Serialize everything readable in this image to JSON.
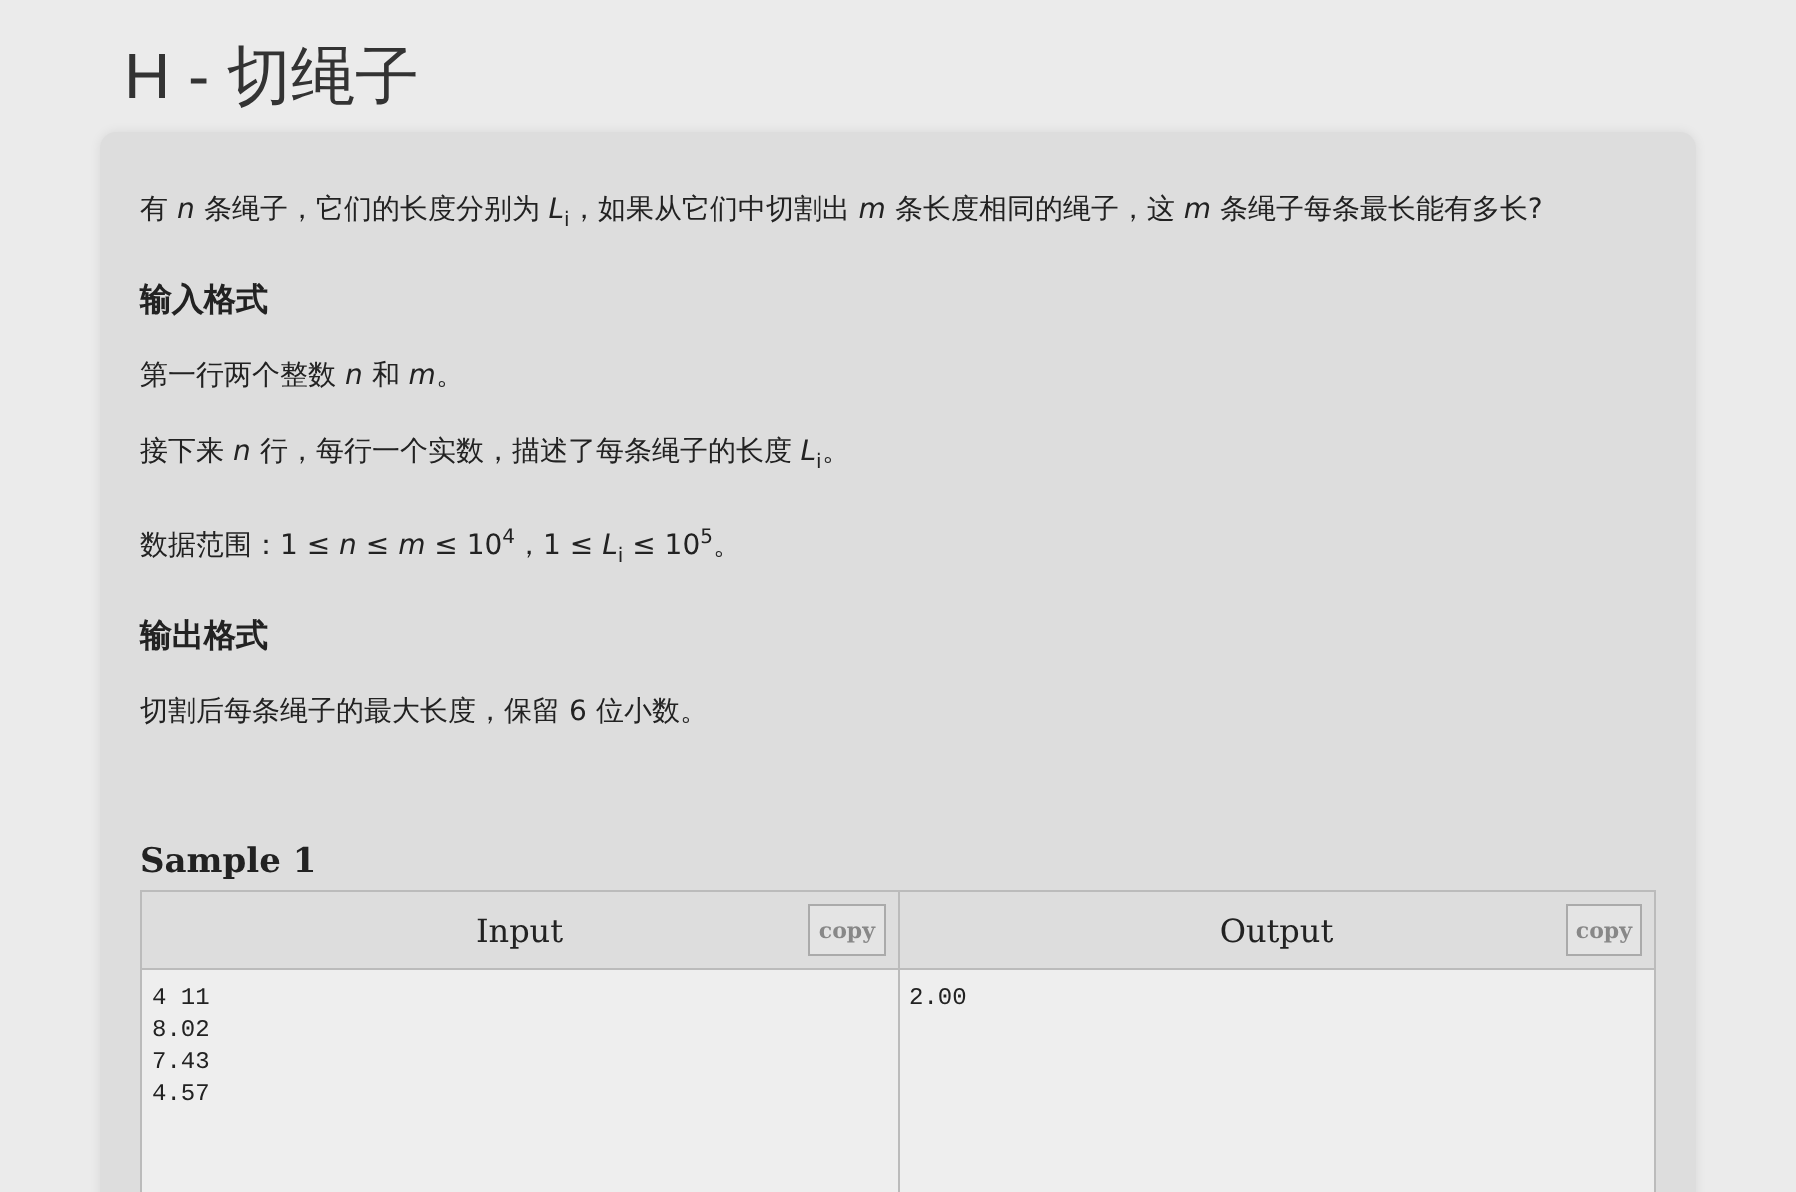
{
  "title": "H - 切绳子",
  "statement": [
    "有 *n* 条绳子，它们的长度分别为 *L*$_{i}$，如果从它们中切割出 *m* 条长度相同的绳子，这 *m* 条绳子每条最长能有多长?"
  ],
  "input_format": {
    "heading": "输入格式",
    "paragraphs": [
      "第一行两个整数 *n* 和 *m*。",
      "接下来 *n* 行，每行一个实数，描述了每条绳子的长度 *L*$_{i}$。",
      "数据范围：1 ≤ *n* ≤ *m* ≤ 10$^{4}$，1 ≤ *L*$_{i}$ ≤ 10$^{5}$。"
    ]
  },
  "output_format": {
    "heading": "输出格式",
    "paragraphs": [
      "切割后每条绳子的最大长度，保留 6 位小数。"
    ]
  },
  "sample": {
    "title": "Sample 1",
    "columns": [
      {
        "heading": "Input",
        "copy": "copy",
        "lines": [
          "4 11",
          "8.02",
          "7.43",
          "4.57"
        ]
      },
      {
        "heading": "Output",
        "copy": "copy",
        "lines": [
          "2.00"
        ]
      }
    ]
  }
}
